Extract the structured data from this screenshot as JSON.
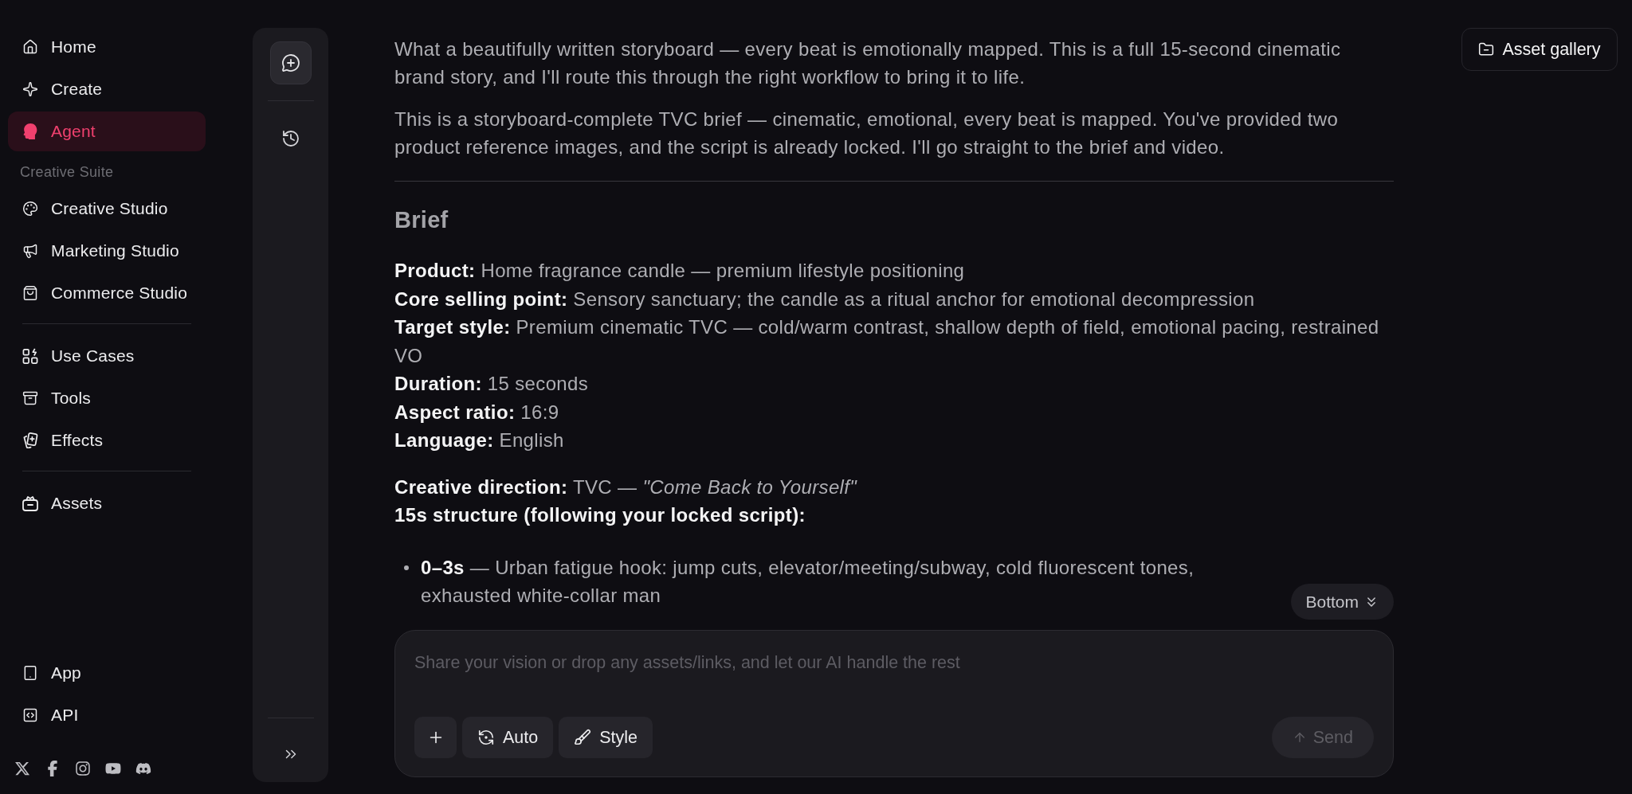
{
  "sidebar": {
    "groups": [
      {
        "items": [
          {
            "label": "Home",
            "selected": false
          },
          {
            "label": "Create",
            "selected": false
          },
          {
            "label": "Agent",
            "selected": true
          }
        ]
      },
      {
        "heading": "Creative Suite",
        "items": [
          {
            "label": "Creative Studio",
            "selected": false
          },
          {
            "label": "Marketing Studio",
            "selected": false
          },
          {
            "label": "Commerce Studio",
            "selected": false
          }
        ]
      },
      {
        "items": [
          {
            "label": "Use Cases",
            "selected": false
          },
          {
            "label": "Tools",
            "selected": false
          },
          {
            "label": "Effects",
            "selected": false
          }
        ]
      },
      {
        "items": [
          {
            "label": "Assets",
            "selected": false
          }
        ]
      }
    ],
    "footer_items": [
      {
        "label": "App"
      },
      {
        "label": "API"
      }
    ]
  },
  "asset_gallery_button": {
    "label": "Asset gallery"
  },
  "conversation": {
    "paragraphs": [
      "What a beautifully written storyboard — every beat is emotionally mapped. This is a full 15-second cinematic brand story, and I'll route this through the right workflow to bring it to life.",
      "This is a storyboard-complete TVC brief — cinematic, emotional, every beat is mapped. You've provided two product reference images, and the script is already locked. I'll go straight to the brief and video."
    ],
    "brief": {
      "heading": "Brief",
      "fields": [
        "**Product:** Home fragrance candle — premium lifestyle positioning",
        "**Core selling point:** Sensory sanctuary; the candle as a ritual anchor for emotional decompression",
        "**Target style:** Premium cinematic TVC — cold/warm contrast, shallow depth of field, emotional pacing, restrained VO",
        "**Duration:** 15 seconds",
        "**Aspect ratio:** 16:9",
        "**Language:** English"
      ],
      "direction": "**Creative direction:** TVC — *\"Come Back to Yourself\"*",
      "structure_heading": "15s structure (following your locked script):",
      "structure": [
        "**0–3s** — Urban fatigue hook: jump cuts, elevator/meeting/subway, cold fluorescent tones, exhausted white-collar man"
      ]
    }
  },
  "scroll_button": {
    "label": "Bottom"
  },
  "composer": {
    "placeholder": "Share your vision or drop any assets/links, and let our AI handle the rest",
    "tools": [
      {
        "label": "Auto"
      },
      {
        "label": "Style"
      }
    ],
    "send": {
      "label": "Send",
      "disabled": true
    }
  }
}
